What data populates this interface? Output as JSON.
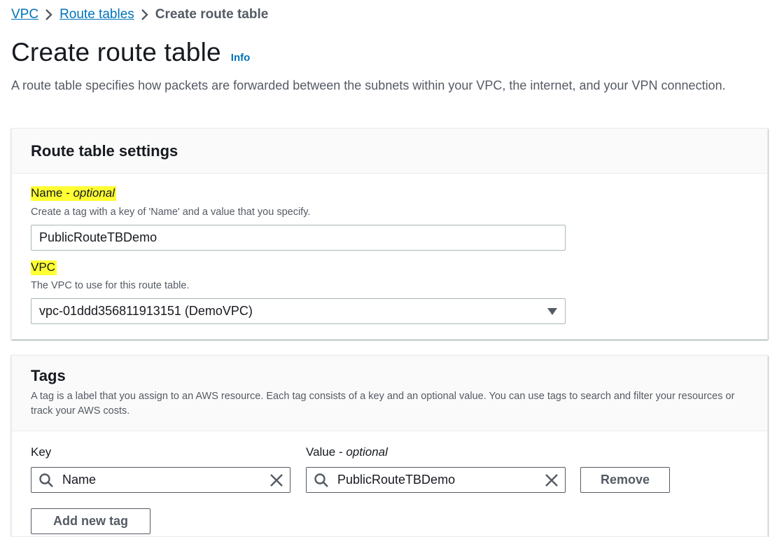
{
  "breadcrumb": {
    "items": [
      "VPC",
      "Route tables"
    ],
    "current": "Create route table"
  },
  "page": {
    "title": "Create route table",
    "info_link": "Info",
    "description": "A route table specifies how packets are forwarded between the subnets within your VPC, the internet, and your VPN connection."
  },
  "settings": {
    "heading": "Route table settings",
    "name_label": "Name - ",
    "name_label_optional": "optional",
    "name_description": "Create a tag with a key of 'Name' and a value that you specify.",
    "name_value": "PublicRouteTBDemo",
    "vpc_label": "VPC",
    "vpc_description": "The VPC to use for this route table.",
    "vpc_value": "vpc-01ddd356811913151 (DemoVPC)"
  },
  "tags": {
    "heading": "Tags",
    "description": "A tag is a label that you assign to an AWS resource. Each tag consists of a key and an optional value. You can use tags to search and filter your resources or track your AWS costs.",
    "key_label": "Key",
    "value_label": "Value - ",
    "value_label_optional": "optional",
    "rows": [
      {
        "key": "Name",
        "value": "PublicRouteTBDemo"
      }
    ],
    "remove_button": "Remove",
    "add_button": "Add new tag"
  },
  "colors": {
    "link": "#0073bb",
    "highlight": "#ffff33",
    "text_secondary": "#545b64"
  }
}
